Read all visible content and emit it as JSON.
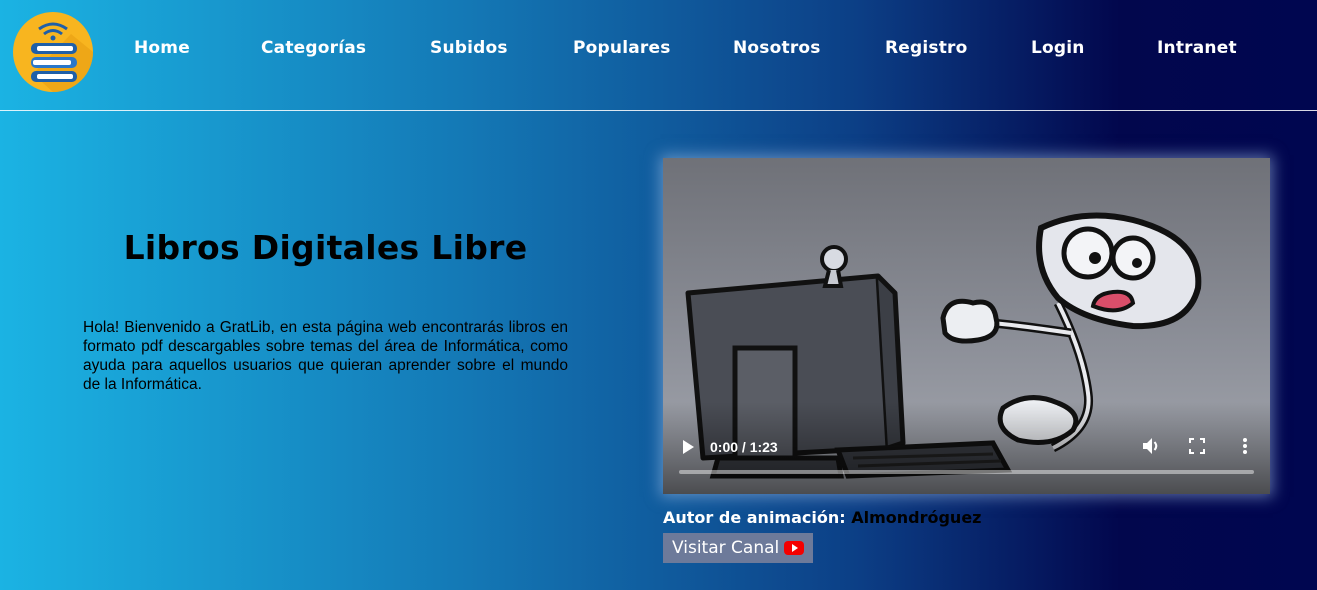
{
  "nav": {
    "items": [
      "Home",
      "Categorías",
      "Subidos",
      "Populares",
      "Nosotros",
      "Registro",
      "Login",
      "Intranet"
    ]
  },
  "hero": {
    "title": "Libros Digitales Libre",
    "text": "Hola! Bienvenido a GratLib, en esta página web encontrarás libros en formato pdf descargables sobre temas del área de Informática, como ayuda para aquellos usuarios que quieran aprender sobre el mundo de la Informática."
  },
  "video": {
    "time": "0:00 / 1:23",
    "progress": 0,
    "icons": [
      "play-icon",
      "volume-icon",
      "fullscreen-icon",
      "more-options-icon"
    ]
  },
  "author": {
    "label": "Autor de animación:",
    "name": "Almondróguez"
  },
  "visit_button": {
    "label": "Visitar Canal",
    "icon": "youtube-icon"
  },
  "colors": {
    "gradient_left": "#1bb3e3",
    "gradient_right": "#000650",
    "logo_bg": "#f8b51f",
    "button_bg": "#6d7a9a",
    "youtube_red": "#f40000"
  }
}
